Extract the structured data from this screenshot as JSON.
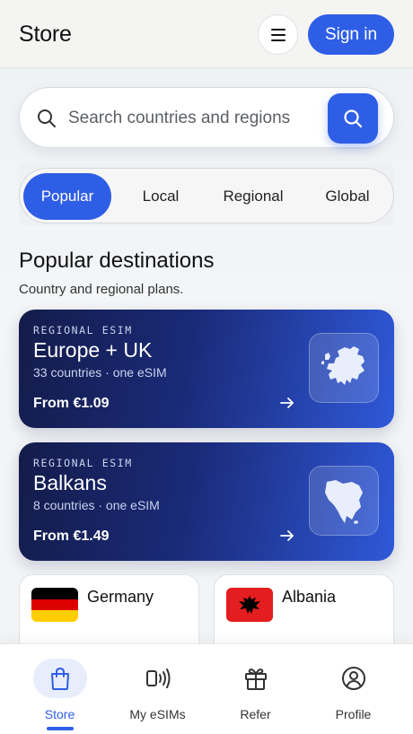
{
  "header": {
    "brand": "Store",
    "signin_label": "Sign in"
  },
  "search": {
    "placeholder": "Search countries and regions"
  },
  "tabs": [
    {
      "label": "Popular",
      "active": true
    },
    {
      "label": "Local",
      "active": false
    },
    {
      "label": "Regional",
      "active": false
    },
    {
      "label": "Global",
      "active": false
    }
  ],
  "section": {
    "title": "Popular destinations",
    "subtitle": "Country and regional plans."
  },
  "regional_cards": [
    {
      "eyebrow": "REGIONAL ESIM",
      "name": "Europe + UK",
      "meta": "33 countries · one eSIM",
      "price": "From €1.09",
      "icon": "europe-map-icon"
    },
    {
      "eyebrow": "REGIONAL ESIM",
      "name": "Balkans",
      "meta": "8 countries · one eSIM",
      "price": "From €1.49",
      "icon": "balkans-map-icon"
    }
  ],
  "country_cards": [
    {
      "name": "Germany",
      "icon": "germany-flag-icon"
    },
    {
      "name": "Albania",
      "icon": "albania-flag-icon"
    }
  ],
  "bottom_nav": [
    {
      "label": "Store",
      "icon": "shopping-bag-icon",
      "active": true
    },
    {
      "label": "My eSIMs",
      "icon": "esim-signal-icon",
      "active": false
    },
    {
      "label": "Refer",
      "icon": "gift-icon",
      "active": false
    },
    {
      "label": "Profile",
      "icon": "user-circle-icon",
      "active": false
    }
  ],
  "colors": {
    "accent": "#2f5ee6",
    "card_dark": "#141c4a",
    "card_light": "#2f59d9"
  }
}
